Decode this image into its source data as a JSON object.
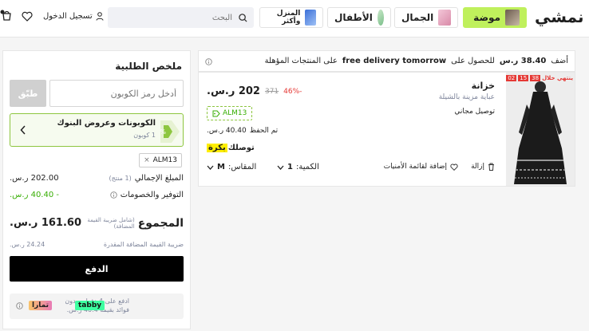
{
  "header": {
    "logo": "نمشي",
    "categories": [
      {
        "label": "موضة"
      },
      {
        "label": "الجمال"
      },
      {
        "label": "الأطفال"
      },
      {
        "label": "المنزل وأكثر"
      }
    ],
    "search_placeholder": "البحث",
    "login_label": "تسجيل الدخول"
  },
  "summary": {
    "title": "ملخص الطلبية",
    "coupon_placeholder": "أدخل رمز الكوبون",
    "apply_label": "طبّق",
    "offers_title": "الكوبونات وعروض البنوك",
    "offers_count": "1 كوبون",
    "applied_coupon": "ALM13",
    "subtotal_label": "المبلغ الإجمالي",
    "subtotal_qty": "(1 منتج)",
    "subtotal_value": "202.00 ر.س.",
    "savings_label": "التوفير والخصومات",
    "savings_value": "- 40.40 ر.س.",
    "total_label": "المجموع",
    "total_vat_note": "(شامل ضريبة القيمة المضافة)",
    "total_value": "161.60 ر.س.",
    "vat_label": "ضريبة القيمة المضافة المقدرة",
    "vat_value": "24.24 ر.س.",
    "pay_label": "الدفع",
    "bnpl_text_1": "ادفع على 4 دفعات بدون",
    "bnpl_text_2": "فوائد بقيمة 40.4 ر.س.",
    "tabby_label": "tabby",
    "tamara_label": "تمارا"
  },
  "cart": {
    "banner_prefix": "أضف",
    "banner_amount": "38.40 ر.س",
    "banner_middle": "للحصول على",
    "banner_bold": "free delivery tomorrow",
    "banner_suffix": "على المنتجات المؤهلة",
    "item": {
      "timer_label": "ينتهي خلال",
      "timer": [
        "38",
        "15",
        "02"
      ],
      "brand": "خزانة",
      "name": "عباية مزينة بالشيلة",
      "shipping": "توصيل مجاني",
      "price": "202 ر.س.",
      "old_price": "371",
      "discount": "-46%",
      "coupon": "ALM13",
      "saved_label": "تم الحفظ",
      "saved_value": "40.40 ر.س.",
      "delivery_prefix": "توصلك",
      "delivery_highlight": "بكرة",
      "qty_label": "الكمية:",
      "qty_value": "1",
      "size_label": "المقاس:",
      "size_value": "M",
      "remove_label": "إزالة",
      "wishlist_label": "إضافة لقائمة الأمنيات"
    }
  },
  "colors": {
    "accent_green": "#38ae04",
    "fashion_tab": "#bff05c",
    "discount_red": "#e53935",
    "highlight_yellow": "#feee00"
  }
}
